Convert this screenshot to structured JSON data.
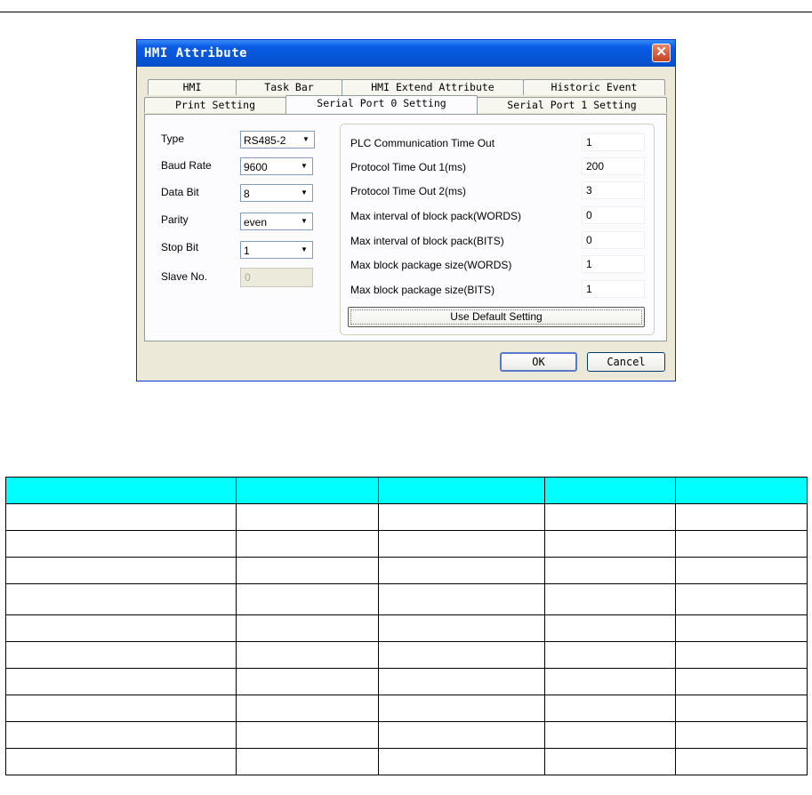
{
  "dialog": {
    "title": "HMI Attribute",
    "close_glyph": "✕",
    "tabs_row1": [
      "HMI",
      "Task Bar",
      "HMI Extend Attribute",
      "Historic Event"
    ],
    "tabs_row2": [
      "Print Setting",
      "Serial Port 0 Setting",
      "Serial Port 1 Setting"
    ],
    "active_tab": "Serial Port 0 Setting",
    "left_form": {
      "type_label": "Type",
      "type_value": "RS485-2",
      "baud_label": "Baud Rate",
      "baud_value": "9600",
      "databit_label": "Data Bit",
      "databit_value": "8",
      "parity_label": "Parity",
      "parity_value": "even",
      "stopbit_label": "Stop Bit",
      "stopbit_value": "1",
      "slave_label": "Slave No.",
      "slave_value": "0"
    },
    "settings": [
      {
        "label": "PLC Communication Time Out",
        "value": "1"
      },
      {
        "label": "Protocol Time Out 1(ms)",
        "value": "200"
      },
      {
        "label": "Protocol Time Out 2(ms)",
        "value": "3"
      },
      {
        "label": "Max interval of block pack(WORDS)",
        "value": "0"
      },
      {
        "label": "Max interval of block pack(BITS)",
        "value": "0"
      },
      {
        "label": "Max block package size(WORDS)",
        "value": "1"
      },
      {
        "label": "Max block package size(BITS)",
        "value": "1"
      }
    ],
    "default_button": "Use Default Setting",
    "ok_button": "OK",
    "cancel_button": "Cancel",
    "dropdown_arrow": "▼",
    "colors": {
      "title_bar": "#0a5ce6",
      "close_button": "#c4421f",
      "dialog_bg": "#ece9d8"
    }
  },
  "table": {
    "header_color": "#00ffff",
    "columns": 5,
    "body_rows": 10
  }
}
